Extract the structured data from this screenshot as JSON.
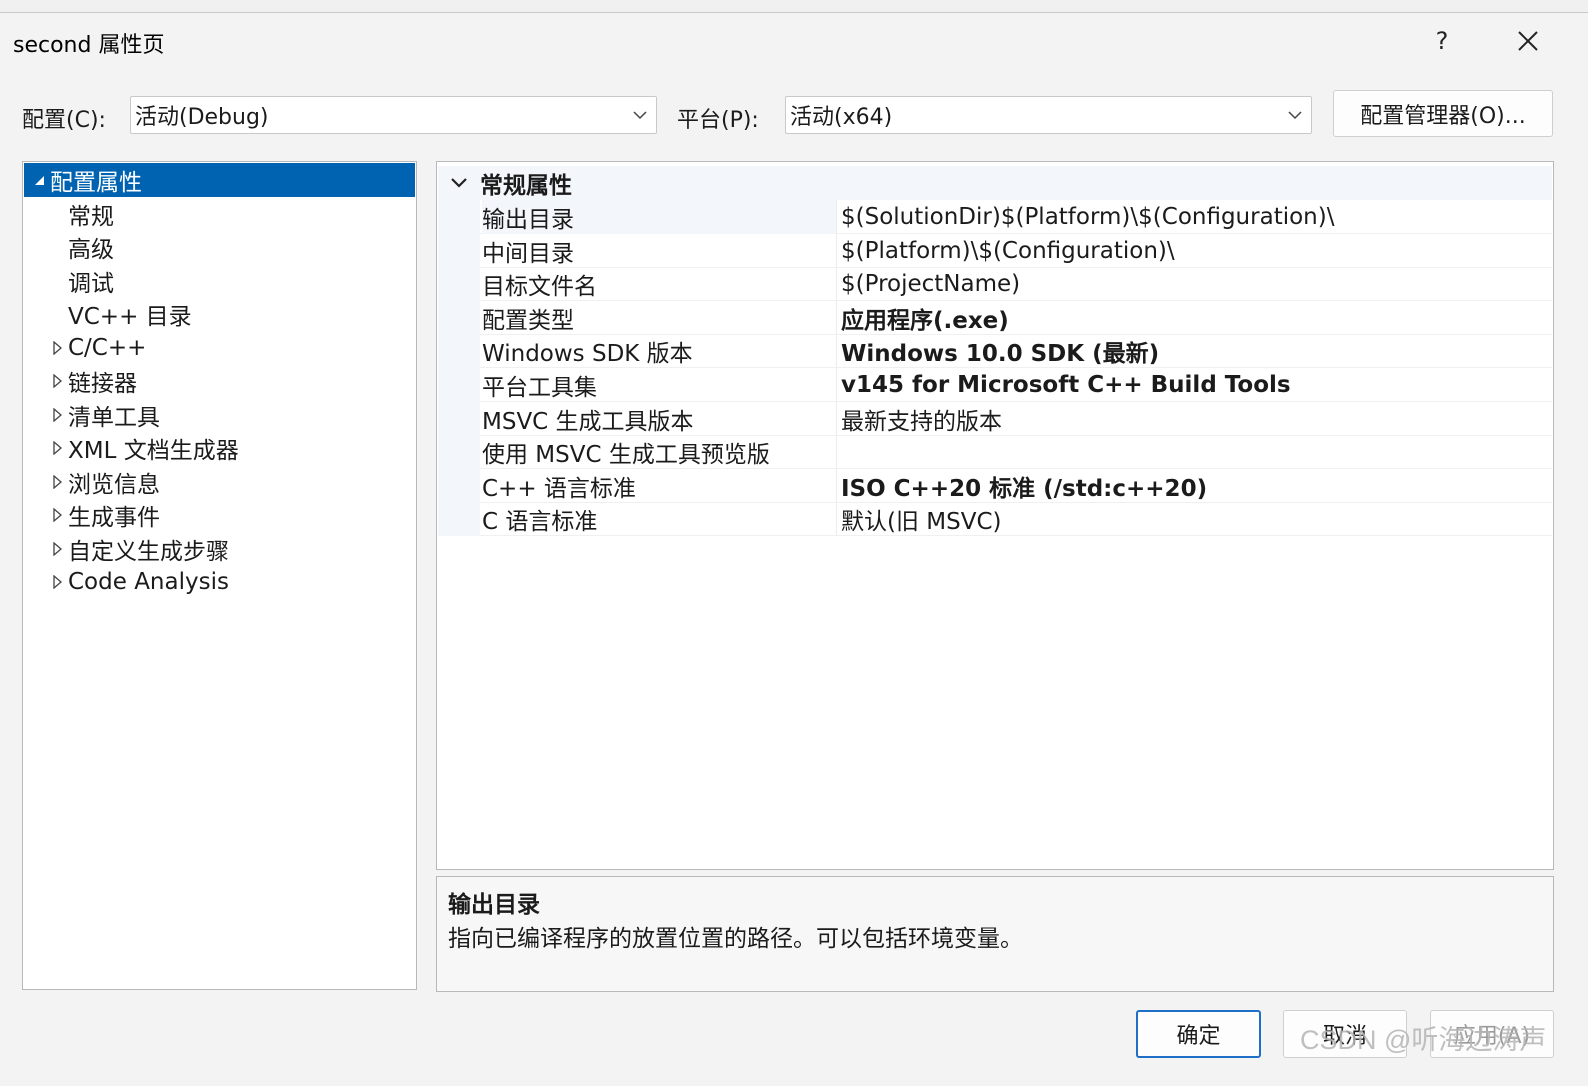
{
  "window": {
    "title": "second 属性页",
    "help": "?",
    "close_icon": "close-icon"
  },
  "toolbar": {
    "config_label": "配置(C):",
    "config_value": "活动(Debug)",
    "platform_label": "平台(P):",
    "platform_value": "活动(x64)",
    "config_manager": "配置管理器(O)..."
  },
  "tree": {
    "items": [
      {
        "label": "配置属性",
        "expander": "expanded",
        "level": 0,
        "selected": true
      },
      {
        "label": "常规",
        "expander": "none",
        "level": 1
      },
      {
        "label": "高级",
        "expander": "none",
        "level": 1
      },
      {
        "label": "调试",
        "expander": "none",
        "level": 1
      },
      {
        "label": "VC++ 目录",
        "expander": "none",
        "level": 1
      },
      {
        "label": "C/C++",
        "expander": "collapsed",
        "level": 1
      },
      {
        "label": "链接器",
        "expander": "collapsed",
        "level": 1
      },
      {
        "label": "清单工具",
        "expander": "collapsed",
        "level": 1
      },
      {
        "label": "XML 文档生成器",
        "expander": "collapsed",
        "level": 1
      },
      {
        "label": "浏览信息",
        "expander": "collapsed",
        "level": 1
      },
      {
        "label": "生成事件",
        "expander": "collapsed",
        "level": 1
      },
      {
        "label": "自定义生成步骤",
        "expander": "collapsed",
        "level": 1
      },
      {
        "label": "Code Analysis",
        "expander": "collapsed",
        "level": 1
      }
    ]
  },
  "grid": {
    "category": "常规属性",
    "rows": [
      {
        "name": "输出目录",
        "value": "$(SolutionDir)$(Platform)\\$(Configuration)\\",
        "bold": false,
        "selected": true
      },
      {
        "name": "中间目录",
        "value": "$(Platform)\\$(Configuration)\\",
        "bold": false
      },
      {
        "name": "目标文件名",
        "value": "$(ProjectName)",
        "bold": false
      },
      {
        "name": "配置类型",
        "value": "应用程序(.exe)",
        "bold": true
      },
      {
        "name": "Windows SDK 版本",
        "value": "Windows 10.0 SDK (最新)",
        "bold": true
      },
      {
        "name": "平台工具集",
        "value": "v145 for Microsoft C++ Build Tools",
        "bold": true
      },
      {
        "name": "MSVC 生成工具版本",
        "value": "最新支持的版本",
        "bold": false
      },
      {
        "name": "使用 MSVC 生成工具预览版",
        "value": "",
        "bold": false
      },
      {
        "name": "C++ 语言标准",
        "value": "ISO C++20 标准 (/std:c++20)",
        "bold": true
      },
      {
        "name": "C 语言标准",
        "value": "默认(旧 MSVC)",
        "bold": false
      }
    ]
  },
  "description": {
    "title": "输出目录",
    "text": "指向已编译程序的放置位置的路径。可以包括环境变量。"
  },
  "buttons": {
    "ok": "确定",
    "cancel": "取消",
    "apply": "应用(A)"
  },
  "watermark": "CSDN @听海边涛声",
  "colors": {
    "selection": "#0063b1",
    "primary_border": "#1f6fc7"
  }
}
